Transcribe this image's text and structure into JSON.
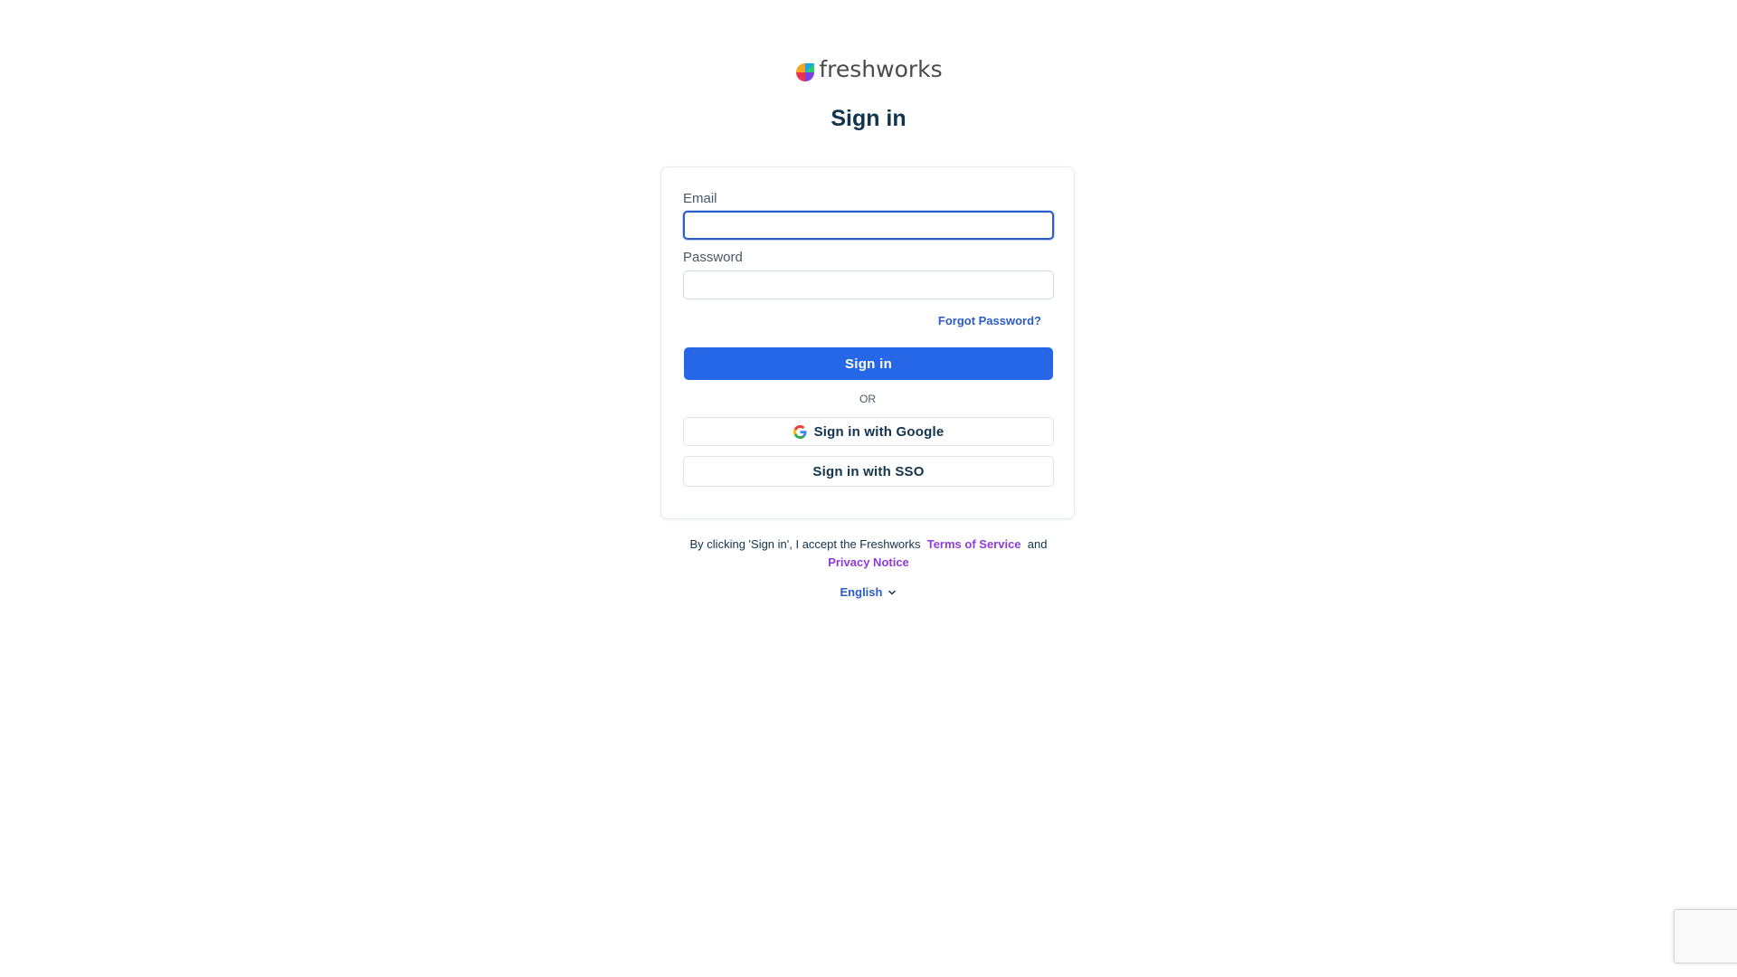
{
  "brand": {
    "name": "freshworks",
    "logo_icon": "freshworks-logo-icon"
  },
  "page": {
    "title": "Sign in"
  },
  "form": {
    "email_label": "Email",
    "email_value": "",
    "password_label": "Password",
    "password_value": "",
    "forgot_password": "Forgot Password?",
    "signin_button": "Sign in",
    "or_text": "OR",
    "google_button": "Sign in with Google",
    "google_icon": "google-icon",
    "sso_button": "Sign in with SSO"
  },
  "legal": {
    "prefix": "By clicking 'Sign in', I accept the Freshworks",
    "terms_link": "Terms of Service",
    "and": "and",
    "privacy_link": "Privacy Notice"
  },
  "language": {
    "selected": "English",
    "icon": "chevron-down-icon"
  },
  "colors": {
    "primary": "#2667e8",
    "link": "#2c5cc5",
    "legal_link": "#8f3cdb",
    "text": "#12344d"
  }
}
